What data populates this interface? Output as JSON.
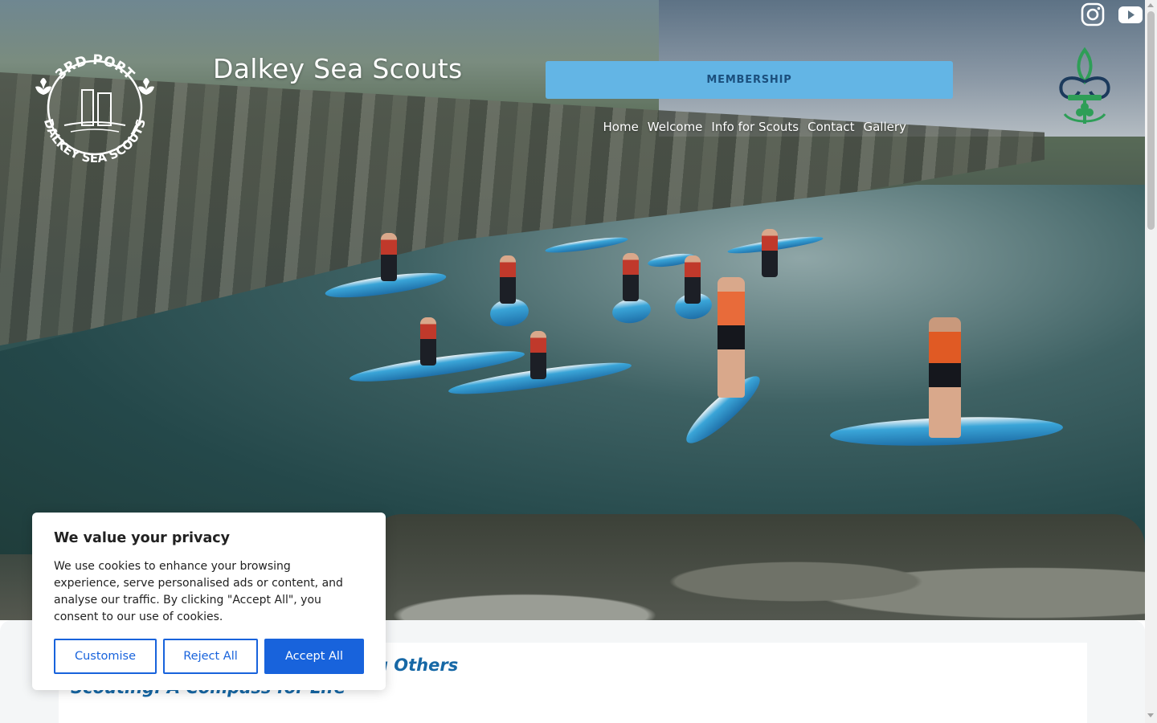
{
  "header": {
    "site_title": "Dalkey Sea Scouts",
    "crest_top_text": "3RD PORT",
    "crest_bottom_text": "DALKEY SEA SCOUTS",
    "membership_label": "MEMBERSHIP"
  },
  "nav": {
    "items": [
      {
        "label": "Home"
      },
      {
        "label": "Welcome"
      },
      {
        "label": "Info for Scouts"
      },
      {
        "label": "Contact"
      },
      {
        "label": "Gallery"
      }
    ]
  },
  "social": {
    "icons": [
      "instagram-icon",
      "youtube-icon"
    ]
  },
  "content": {
    "heading_1": "ng Others",
    "heading_2": "Scouting: A Compass for Life"
  },
  "cookie": {
    "title": "We value your privacy",
    "text": "We use cookies to enhance your browsing experience, serve personalised ads or content, and analyse our traffic. By clicking \"Accept All\", you consent to our use of cookies.",
    "customise_label": "Customise",
    "reject_label": "Reject All",
    "accept_label": "Accept All"
  },
  "colors": {
    "membership_bg": "#63b5e5",
    "accent_blue": "#1863dc",
    "heading_blue": "#1668a6",
    "badge_green": "#2e9e57",
    "badge_navy": "#1b3a5c"
  }
}
